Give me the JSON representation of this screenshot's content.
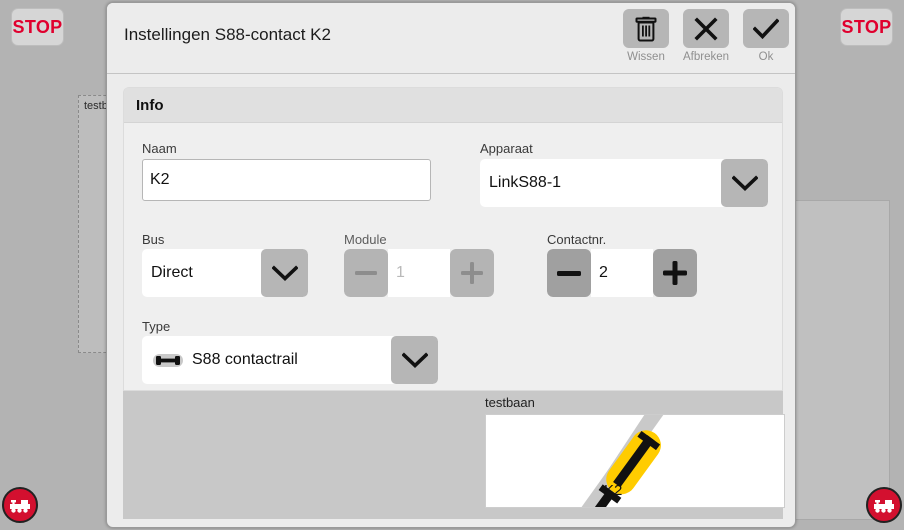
{
  "desktop": {
    "stop_left_label": "STOP",
    "stop_right_label": "STOP",
    "bg_panel_label": "testba"
  },
  "dialog": {
    "title": "Instellingen S88-contact K2",
    "toolbar": [
      {
        "label": "Wissen",
        "icon": "trash-icon"
      },
      {
        "label": "Afbreken",
        "icon": "close-icon"
      },
      {
        "label": "Ok",
        "icon": "check-icon"
      }
    ],
    "info": {
      "header": "Info",
      "naam": {
        "label": "Naam",
        "value": "K2"
      },
      "apparaat": {
        "label": "Apparaat",
        "value": "LinkS88-1"
      },
      "bus": {
        "label": "Bus",
        "value": "Direct"
      },
      "module": {
        "label": "Module",
        "value": "1",
        "minus": "—",
        "plus": "+",
        "enabled": false
      },
      "contactnr": {
        "label": "Contactnr.",
        "value": "2",
        "minus": "—",
        "plus": "+",
        "enabled": true
      },
      "type": {
        "label": "Type",
        "value": "S88 contactrail",
        "icon": "s88-rail-icon"
      }
    },
    "preview": {
      "label": "testbaan",
      "contact_label": "K2",
      "track_color": "#c9c9c9",
      "highlight_color": "#ffcc00",
      "contact_color": "#111111"
    }
  },
  "colors": {
    "accent_red": "#d3102f",
    "stop_text": "#e0002e",
    "dialog_bg": "#ececec",
    "desktop_bg": "#b3b3b3",
    "button_gray": "#b6b6b6",
    "spinner_enabled": "#a0a0a0",
    "spinner_disabled": "#b4b4b4"
  }
}
